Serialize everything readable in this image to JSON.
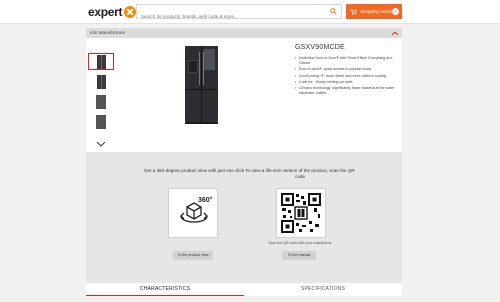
{
  "header": {
    "logo_text": "expert",
    "search_placeholder": "Search for products, brands, web code & more...",
    "basket_label": "Shopping basket",
    "basket_count": "0",
    "accent_color": "#f16922"
  },
  "info_bar": {
    "label": "Info Manufacturer"
  },
  "product": {
    "model": "GSXV90MCDE",
    "features": [
      "InstaView Door-in-Door® with Show Effect: Everything at a Glance",
      "Door-in-door®: quick access to popular foods",
      "DoorCooling+®: much faster and more uniform cooling",
      "Craft Ice : Slowly melting ice balls",
      "UVnano technology: significantly fewer bacteria at the water dispenser outlets"
    ]
  },
  "view360": {
    "title": "Get a 360-degree product view with just one click",
    "badge": "360°",
    "button_label": "To the product view"
  },
  "qr": {
    "title": "To view a life-size version of the product, scan the QR code",
    "caption": "Scan the QR code with your smartphone",
    "button_label": "To the manual"
  },
  "tabs": [
    {
      "label": "CHARACTERISTICS",
      "active": true
    },
    {
      "label": "SPECIFICATIONS",
      "active": false
    }
  ]
}
